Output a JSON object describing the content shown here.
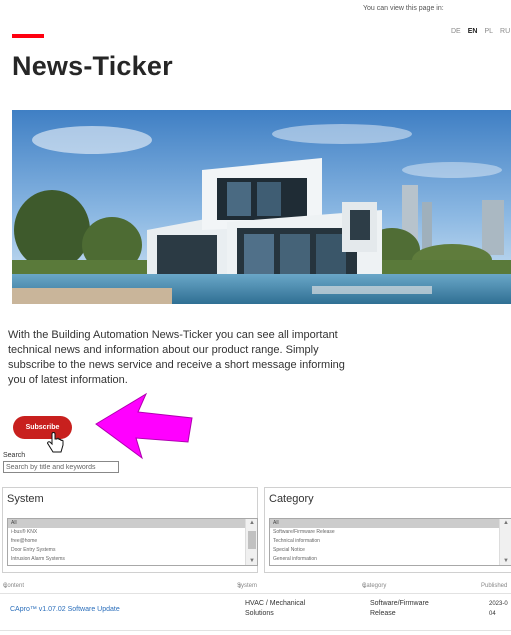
{
  "header": {
    "lang_note": "You can view this page in:",
    "languages": [
      "DE",
      "EN",
      "PL",
      "RU"
    ],
    "active_language": "EN"
  },
  "page": {
    "title": "News-Ticker",
    "intro": "With the Building Automation News-Ticker you can see all important technical news and information about our product range. Simply subscribe to the news service and receive a short message informing you of latest information.",
    "subscribe_label": "Subscribe"
  },
  "search": {
    "label": "Search",
    "placeholder": "Search by title and keywords"
  },
  "filters": {
    "system": {
      "title": "System",
      "options": [
        "All",
        "i-bus® KNX",
        "free@home",
        "Door Entry Systems",
        "Intrusion Alarm Systems"
      ]
    },
    "category": {
      "title": "Category",
      "options": [
        "All",
        "Software/Firmware Release",
        "Technical information",
        "Special Notice",
        "General information"
      ]
    }
  },
  "table": {
    "headers": {
      "content": "Content",
      "system": "System",
      "category": "Category",
      "published": "Published"
    },
    "rows": [
      {
        "content": "CApro™ v1.07.02 Software Update",
        "system_line1": "HVAC / Mechanical",
        "system_line2": "Solutions",
        "category_line1": "Software/Firmware",
        "category_line2": "Release",
        "published_line1": "2023-0",
        "published_line2": "04"
      }
    ]
  },
  "colors": {
    "brand_red": "#ff000f",
    "subscribe_red": "#c8201e",
    "arrow_magenta": "#ff00ff",
    "link_blue": "#2a6ebb"
  },
  "icons": [
    "sort-icon",
    "hand-cursor-icon",
    "arrow-pointer-icon",
    "scroll-up-icon",
    "scroll-down-icon"
  ]
}
